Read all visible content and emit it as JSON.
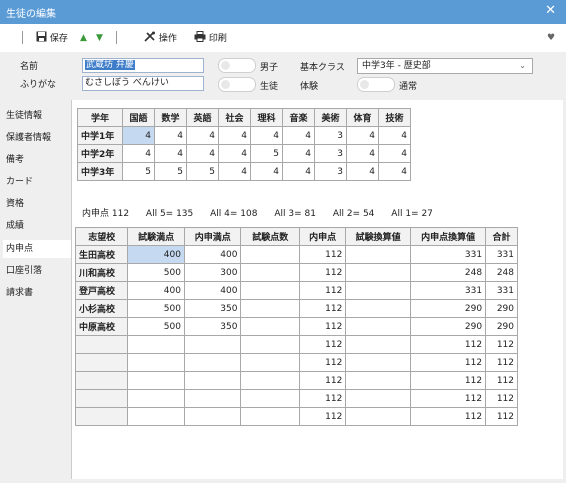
{
  "window": {
    "title": "生徒の編集",
    "close": "✕"
  },
  "toolbar": {
    "save": "保存",
    "up": "▲",
    "down": "▼",
    "operation": "操作",
    "print": "印刷",
    "favorite": "♥"
  },
  "form": {
    "name_label": "名前",
    "furigana_label": "ふりがな",
    "name_value": "武蔵坊 弁慶",
    "furigana_value": "むさしぼう べんけい",
    "gender_label": "男子",
    "status_label": "生徒",
    "class_label": "基本クラス",
    "class_value": "中学3年 - 歴史部",
    "exam_label": "体験",
    "exam_value": "通常"
  },
  "sidebar": {
    "items": [
      "生徒情報",
      "保護者情報",
      "備考",
      "カード",
      "資格",
      "成績",
      "内申点",
      "口座引落",
      "請求書"
    ],
    "active": "内申点"
  },
  "grades": {
    "headers": [
      "学年",
      "国語",
      "数学",
      "英語",
      "社会",
      "理科",
      "音楽",
      "美術",
      "体育",
      "技術"
    ],
    "rows": [
      {
        "label": "中学1年",
        "values": [
          "4",
          "4",
          "4",
          "4",
          "4",
          "4",
          "3",
          "4",
          "4"
        ]
      },
      {
        "label": "中学2年",
        "values": [
          "4",
          "4",
          "4",
          "4",
          "5",
          "4",
          "3",
          "4",
          "4"
        ]
      },
      {
        "label": "中学3年",
        "values": [
          "5",
          "5",
          "5",
          "4",
          "4",
          "4",
          "3",
          "4",
          "4"
        ]
      }
    ]
  },
  "summary": {
    "naishin": "内申点 112",
    "all5": "All 5= 135",
    "all4": "All 4= 108",
    "all3": "All 3= 81",
    "all2": "All 2= 54",
    "all1": "All 1= 27"
  },
  "schools": {
    "headers": [
      "志望校",
      "試験満点",
      "内申満点",
      "試験点数",
      "内申点",
      "試験換算値",
      "内申点換算値",
      "合計"
    ],
    "rows": [
      [
        "生田高校",
        "400",
        "400",
        "",
        "112",
        "",
        "331",
        "331"
      ],
      [
        "川和高校",
        "500",
        "300",
        "",
        "112",
        "",
        "248",
        "248"
      ],
      [
        "登戸高校",
        "400",
        "400",
        "",
        "112",
        "",
        "331",
        "331"
      ],
      [
        "小杉高校",
        "500",
        "350",
        "",
        "112",
        "",
        "290",
        "290"
      ],
      [
        "中原高校",
        "500",
        "350",
        "",
        "112",
        "",
        "290",
        "290"
      ],
      [
        "",
        "",
        "",
        "",
        "112",
        "",
        "112",
        "112"
      ],
      [
        "",
        "",
        "",
        "",
        "112",
        "",
        "112",
        "112"
      ],
      [
        "",
        "",
        "",
        "",
        "112",
        "",
        "112",
        "112"
      ],
      [
        "",
        "",
        "",
        "",
        "112",
        "",
        "112",
        "112"
      ],
      [
        "",
        "",
        "",
        "",
        "112",
        "",
        "112",
        "112"
      ]
    ]
  }
}
